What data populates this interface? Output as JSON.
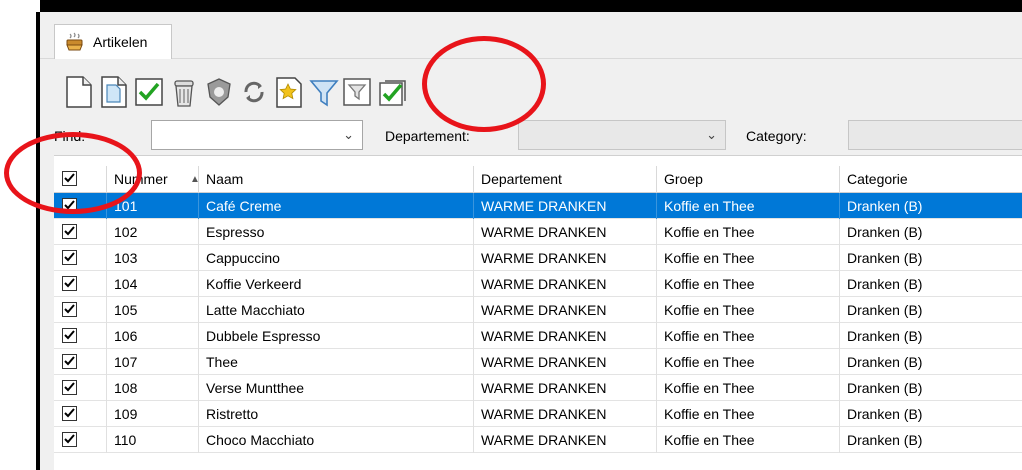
{
  "tab": {
    "label": "Artikelen",
    "icon": "coffee-cup-icon"
  },
  "toolbar": {
    "buttons": [
      {
        "name": "new-document-icon"
      },
      {
        "name": "copy-document-icon"
      },
      {
        "name": "checkmark-icon"
      },
      {
        "name": "trash-bin-icon"
      },
      {
        "name": "shield-icon"
      },
      {
        "name": "refresh-icon"
      },
      {
        "name": "favorite-star-icon"
      },
      {
        "name": "filter-icon"
      },
      {
        "name": "filter-disabled-icon"
      },
      {
        "name": "select-all-icon"
      }
    ]
  },
  "filters": {
    "find_label": "Find:",
    "find_value": "",
    "departement_label": "Departement:",
    "departement_value": "",
    "category_label": "Category:",
    "category_value": ""
  },
  "grid": {
    "columns": [
      "Nummer",
      "Naam",
      "Departement",
      "Groep",
      "Categorie"
    ],
    "sort_column": "Nummer",
    "sort_direction": "ascending",
    "rows": [
      {
        "checked": true,
        "nummer": "101",
        "naam": "Café Creme",
        "departement": "WARME DRANKEN",
        "groep": "Koffie en Thee",
        "categorie": "Dranken (B)",
        "selected": true
      },
      {
        "checked": true,
        "nummer": "102",
        "naam": "Espresso",
        "departement": "WARME DRANKEN",
        "groep": "Koffie en Thee",
        "categorie": "Dranken (B)"
      },
      {
        "checked": true,
        "nummer": "103",
        "naam": "Cappuccino",
        "departement": "WARME DRANKEN",
        "groep": "Koffie en Thee",
        "categorie": "Dranken (B)"
      },
      {
        "checked": true,
        "nummer": "104",
        "naam": "Koffie Verkeerd",
        "departement": "WARME DRANKEN",
        "groep": "Koffie en Thee",
        "categorie": "Dranken (B)"
      },
      {
        "checked": true,
        "nummer": "105",
        "naam": "Latte Macchiato",
        "departement": "WARME DRANKEN",
        "groep": "Koffie en Thee",
        "categorie": "Dranken (B)"
      },
      {
        "checked": true,
        "nummer": "106",
        "naam": "Dubbele Espresso",
        "departement": "WARME DRANKEN",
        "groep": "Koffie en Thee",
        "categorie": "Dranken (B)"
      },
      {
        "checked": true,
        "nummer": "107",
        "naam": "Thee",
        "departement": "WARME DRANKEN",
        "groep": "Koffie en Thee",
        "categorie": "Dranken (B)"
      },
      {
        "checked": true,
        "nummer": "108",
        "naam": "Verse Muntthee",
        "departement": "WARME DRANKEN",
        "groep": "Koffie en Thee",
        "categorie": "Dranken (B)"
      },
      {
        "checked": true,
        "nummer": "109",
        "naam": "Ristretto",
        "departement": "WARME DRANKEN",
        "groep": "Koffie en Thee",
        "categorie": "Dranken (B)"
      },
      {
        "checked": true,
        "nummer": "110",
        "naam": "Choco Macchiato",
        "departement": "WARME DRANKEN",
        "groep": "Koffie en Thee",
        "categorie": "Dranken (B)"
      }
    ]
  },
  "colors": {
    "selection": "#0078d7",
    "annotation": "#e8141a",
    "check": "#1e8c1e"
  }
}
